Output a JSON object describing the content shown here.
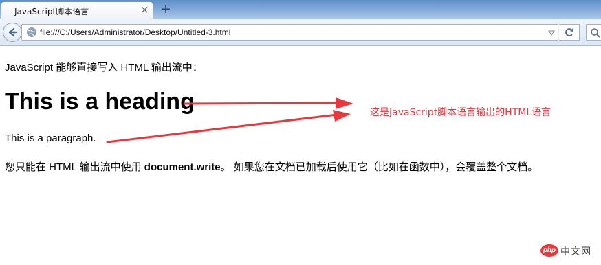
{
  "browser": {
    "tab_title": "JavaScript脚本语言",
    "tab_close": "×",
    "new_tab": "+",
    "url": "file:///C:/Users/Administrator/Desktop/Untitled-3.html"
  },
  "page": {
    "intro": "JavaScript 能够直接写入 HTML 输出流中：",
    "heading": "This is a heading",
    "paragraph": "This is a paragraph.",
    "note_before": "您只能在 HTML 输出流中使用 ",
    "note_code": "document.write",
    "note_after": "。 如果您在文档已加载后使用它（比如在函数中），会覆盖整个文档。"
  },
  "annotation": {
    "text": "这是JavaScript脚本语言输出的HTML语言",
    "color": "#e8383d"
  },
  "watermark": {
    "badge": "php",
    "text": "中文网",
    "badge_color": "#e33b3b"
  },
  "icons": [
    "back-arrow-icon",
    "globe-icon",
    "dropdown-arrow-icon",
    "reload-icon",
    "search-icon",
    "close-icon",
    "plus-icon"
  ]
}
